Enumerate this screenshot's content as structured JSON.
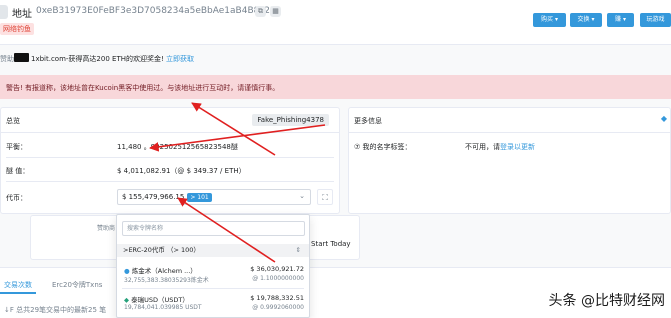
{
  "header": {
    "title": "地址",
    "address": "0xeB31973E0FeBF3e3D7058234a5eBbAe1aB4B8c23",
    "phish_tag": "网络钓鱼",
    "buttons": [
      "购买 ▾",
      "交换 ▾",
      "赚 ▾",
      "玩游戏"
    ]
  },
  "sponsor": {
    "prefix": "赞助:",
    "text": "1xbit.com-获得高达200 ETH的欢迎奖金!",
    "link": "立即获取"
  },
  "warning": {
    "text": "警告! 有报道称，该地址曾在Kucoin黑客中使用过。与该地址进行互动时，请谨慎行事。"
  },
  "overview": {
    "title": "总览",
    "tag": "Fake_Phishing4378",
    "balance_label": "平衡：",
    "balance_value": "11,480 。902502512565823548醚",
    "value_label": "醚 值：",
    "value_value": "$ 4,011,082.91（@ $ 349.37 / ETH）",
    "token_label": "代币：",
    "token_value": "$ 155,479,966.15",
    "token_count": "> 101"
  },
  "moreinfo": {
    "title": "更多信息",
    "name_tag_label": "⑦ 我的名字标签：",
    "name_tag_value": "不可用，请",
    "name_tag_link": "登录以更新"
  },
  "dropdown": {
    "search_placeholder": "搜索令牌名称",
    "group_label": ">ERC-20代币 （> 100）",
    "tokens": [
      {
        "name": "炼金术（Alchem ...）",
        "amount": "32,755,383.38035293炼金术",
        "usd": "$ 36,030,921.72",
        "rate": "@ 1.1000000000"
      },
      {
        "name": "泰瑞USD（USDT）",
        "amount": "19,784,041.039985 USDT",
        "usd": "$ 19,788,332.51",
        "rate": "@ 0.9992060000"
      }
    ]
  },
  "banner": {
    "left_label": "赞助商",
    "right_text": "Start Today"
  },
  "tabs": {
    "items": [
      "交易次数",
      "Erc20令牌Txns"
    ],
    "tx_count_text": "↓F 总共29笔交易中的最新25 笔"
  },
  "watermark": "头条 @比特财经网"
}
